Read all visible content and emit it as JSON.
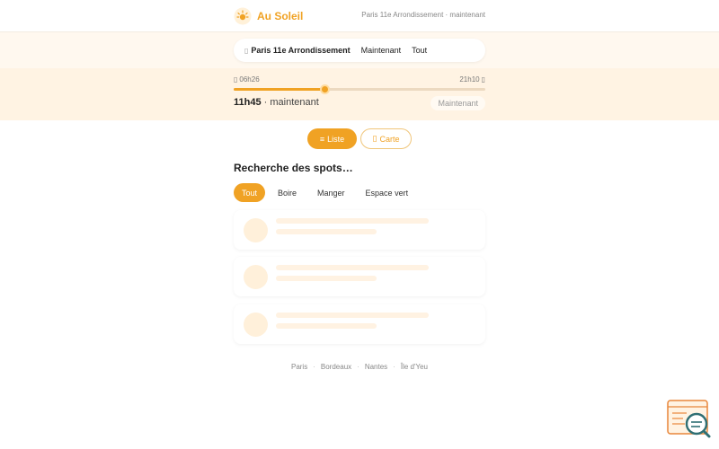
{
  "header": {
    "brand": "Au Soleil",
    "subtitle": "Paris 11e Arrondissement · maintenant"
  },
  "location": {
    "city": "Paris 11e Arrondissement",
    "time_option": "Maintenant",
    "scope_option": "Tout"
  },
  "time": {
    "sunrise": "06h26",
    "sunset": "21h10",
    "current_time": "11h45",
    "current_suffix": "· maintenant",
    "now_button": "Maintenant",
    "slider_value_fraction": 0.36
  },
  "view_toggle": {
    "list_label": "Liste",
    "map_label": "Carte"
  },
  "section_title": "Recherche des spots…",
  "filters": [
    "Tout",
    "Boire",
    "Manger",
    "Espace vert"
  ],
  "footer": {
    "links": [
      "Paris",
      "Bordeaux",
      "Nantes",
      "Île d'Yeu"
    ]
  },
  "colors": {
    "accent": "#f0a224",
    "band_light": "#fff8ef",
    "band": "#fff3e3"
  },
  "icons": {
    "logo": "sun-icon",
    "location": "pin-icon",
    "sunrise": "sunrise-icon",
    "sunset": "sunset-icon",
    "list": "list-icon",
    "map": "map-icon"
  }
}
